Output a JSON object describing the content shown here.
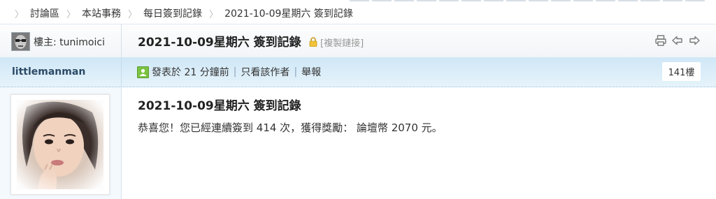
{
  "breadcrumb": [
    "討論區",
    "本站事務",
    "每日簽到記錄",
    "2021-10-09星期六 簽到記錄"
  ],
  "thread": {
    "op_label": "樓主: tunimoici",
    "title": "2021-10-09星期六 簽到記錄",
    "copy_link": "[複製鏈接]",
    "icons": [
      "print-icon",
      "prev-thread-icon",
      "next-thread-icon",
      "lock-icon"
    ]
  },
  "post": {
    "author": "littlemanman",
    "posted": "發表於 21 分鐘前",
    "only_author": "只看該作者",
    "report": "舉報",
    "floor": "141樓",
    "title": "2021-10-09星期六 簽到記錄",
    "message": "恭喜您！您已經連續簽到 414 次，獲得獎勵： 論壇幣 2070 元。"
  },
  "colors": {
    "author_bar": "#d4eaf8",
    "border": "#b9cfe3",
    "author_name": "#2b4a66",
    "online_icon": "#6bbf3a"
  }
}
